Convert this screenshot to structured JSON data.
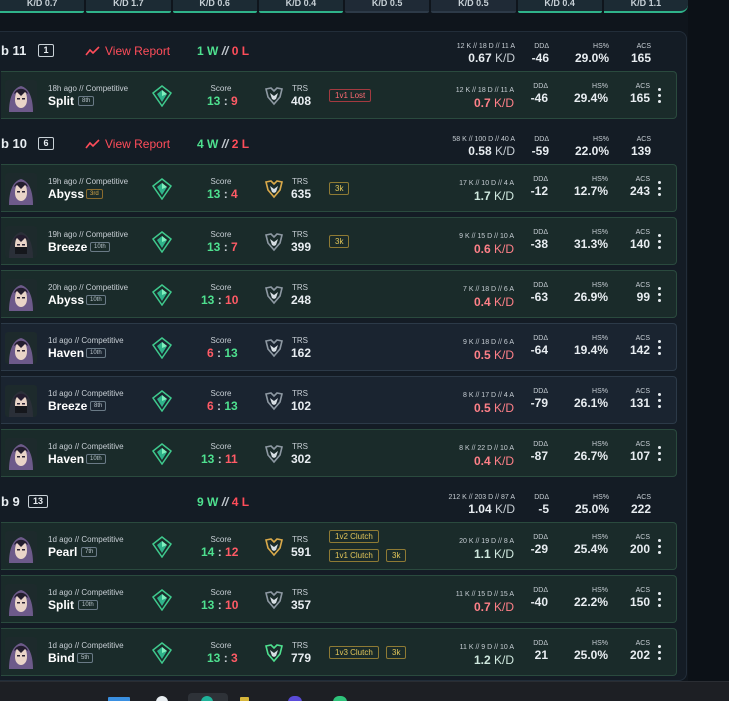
{
  "top_tabs": [
    "K/D 0.7",
    "K/D 1.7",
    "K/D 0.6",
    "K/D 0.4",
    "K/D 0.5",
    "K/D 0.5",
    "K/D 0.4",
    "K/D 1.1"
  ],
  "sessions": [
    {
      "title": "b 11",
      "count": "1",
      "report": "View Report",
      "wins": "1 W",
      "sep": "//",
      "losses": "0 L",
      "kda_line": "12 K // 18 D // 11 A",
      "kd": "0.67",
      "kd_unit": "K/D",
      "dda_label": "DDΔ",
      "dda": "-46",
      "hs_label": "HS%",
      "hs": "29.0%",
      "acs_label": "ACS",
      "acs": "165",
      "matches": [
        {
          "time": "18h ago // Competitive",
          "map": "Split",
          "place": "8th",
          "score_label": "Score",
          "score_a": "13",
          "score_b": "9",
          "score_sep": ":",
          "score_a_win": true,
          "trs_label": "TRS",
          "trs": "408",
          "tags": [
            {
              "text": "1v1 Lost",
              "style": "red"
            }
          ],
          "kda_line": "12 K // 18 D // 11 A",
          "kd": "0.7",
          "kd_unit": "K/D",
          "kd_good": false,
          "dda": "-46",
          "hs": "29.4%",
          "acs": "165",
          "win": true
        }
      ]
    },
    {
      "title": "b 10",
      "count": "6",
      "report": "View Report",
      "wins": "4 W",
      "sep": "//",
      "losses": "2 L",
      "kda_line": "58 K // 100 D // 40 A",
      "kd": "0.58",
      "kd_unit": "K/D",
      "dda_label": "DDΔ",
      "dda": "-59",
      "hs_label": "HS%",
      "hs": "22.0%",
      "acs_label": "ACS",
      "acs": "139",
      "matches": [
        {
          "time": "19h ago // Competitive",
          "map": "Abyss",
          "place": "3rd",
          "place_gold": true,
          "score_label": "Score",
          "score_a": "13",
          "score_b": "4",
          "score_sep": ":",
          "score_a_win": true,
          "trs_label": "TRS",
          "trs": "635",
          "trs_gold": true,
          "tags": [
            {
              "text": "3k",
              "style": "gold"
            }
          ],
          "kda_line": "17 K // 10 D // 4 A",
          "kd": "1.7",
          "kd_unit": "K/D",
          "kd_good": true,
          "dda": "-12",
          "hs": "12.7%",
          "acs": "243",
          "win": true
        },
        {
          "time": "19h ago // Competitive",
          "map": "Breeze",
          "place": "10th",
          "score_label": "Score",
          "score_a": "13",
          "score_b": "7",
          "score_sep": ":",
          "score_a_win": true,
          "trs_label": "TRS",
          "trs": "399",
          "tags": [
            {
              "text": "3k",
              "style": "gold"
            }
          ],
          "kda_line": "9 K // 15 D // 10 A",
          "kd": "0.6",
          "kd_unit": "K/D",
          "kd_good": false,
          "dda": "-38",
          "hs": "31.3%",
          "acs": "140",
          "win": true
        },
        {
          "time": "20h ago // Competitive",
          "map": "Abyss",
          "place": "10th",
          "score_label": "Score",
          "score_a": "13",
          "score_b": "10",
          "score_sep": ":",
          "score_a_win": true,
          "trs_label": "TRS",
          "trs": "248",
          "tags": [],
          "kda_line": "7 K // 18 D // 6 A",
          "kd": "0.4",
          "kd_unit": "K/D",
          "kd_good": false,
          "dda": "-63",
          "hs": "26.9%",
          "acs": "99",
          "win": true
        },
        {
          "time": "1d ago // Competitive",
          "map": "Haven",
          "place": "10th",
          "score_label": "Score",
          "score_a": "6",
          "score_b": "13",
          "score_sep": ":",
          "score_a_win": false,
          "trs_label": "TRS",
          "trs": "162",
          "tags": [],
          "kda_line": "9 K // 18 D // 6 A",
          "kd": "0.5",
          "kd_unit": "K/D",
          "kd_good": false,
          "dda": "-64",
          "hs": "19.4%",
          "acs": "142",
          "win": false
        },
        {
          "time": "1d ago // Competitive",
          "map": "Breeze",
          "place": "8th",
          "score_label": "Score",
          "score_a": "6",
          "score_b": "13",
          "score_sep": ":",
          "score_a_win": false,
          "trs_label": "TRS",
          "trs": "102",
          "tags": [],
          "kda_line": "8 K // 17 D // 4 A",
          "kd": "0.5",
          "kd_unit": "K/D",
          "kd_good": false,
          "dda": "-79",
          "hs": "26.1%",
          "acs": "131",
          "win": false
        },
        {
          "time": "1d ago // Competitive",
          "map": "Haven",
          "place": "10th",
          "score_label": "Score",
          "score_a": "13",
          "score_b": "11",
          "score_sep": ":",
          "score_a_win": true,
          "trs_label": "TRS",
          "trs": "302",
          "tags": [],
          "kda_line": "8 K // 22 D // 10 A",
          "kd": "0.4",
          "kd_unit": "K/D",
          "kd_good": false,
          "dda": "-87",
          "hs": "26.7%",
          "acs": "107",
          "win": true
        }
      ]
    },
    {
      "title": "b 9",
      "count": "13",
      "report": "",
      "wins": "9 W",
      "sep": "//",
      "losses": "4 L",
      "kda_line": "212 K // 203 D // 87 A",
      "kd": "1.04",
      "kd_unit": "K/D",
      "dda_label": "DDΔ",
      "dda": "-5",
      "hs_label": "HS%",
      "hs": "25.0%",
      "acs_label": "ACS",
      "acs": "222",
      "matches": [
        {
          "time": "1d ago // Competitive",
          "map": "Pearl",
          "place": "7th",
          "score_label": "Score",
          "score_a": "14",
          "score_b": "12",
          "score_sep": ":",
          "score_a_win": true,
          "trs_label": "TRS",
          "trs": "591",
          "trs_gold": true,
          "tags": [
            {
              "text": "1v2 Clutch",
              "style": "gold"
            },
            {
              "text": "1v1 Clutch",
              "style": "gold"
            },
            {
              "text": "3k",
              "style": "gold"
            }
          ],
          "kda_line": "20 K // 19 D // 8 A",
          "kd": "1.1",
          "kd_unit": "K/D",
          "kd_good": true,
          "dda": "-29",
          "hs": "25.4%",
          "acs": "200",
          "win": true
        },
        {
          "time": "1d ago // Competitive",
          "map": "Split",
          "place": "10th",
          "score_label": "Score",
          "score_a": "13",
          "score_b": "10",
          "score_sep": ":",
          "score_a_win": true,
          "trs_label": "TRS",
          "trs": "357",
          "tags": [],
          "kda_line": "11 K // 15 D // 15 A",
          "kd": "0.7",
          "kd_unit": "K/D",
          "kd_good": false,
          "dda": "-40",
          "hs": "22.2%",
          "acs": "150",
          "win": true
        },
        {
          "time": "1d ago // Competitive",
          "map": "Bind",
          "place": "5th",
          "score_label": "Score",
          "score_a": "13",
          "score_b": "3",
          "score_sep": ":",
          "score_a_win": true,
          "trs_label": "TRS",
          "trs": "779",
          "trs_green": true,
          "tags": [
            {
              "text": "1v3 Clutch",
              "style": "gold"
            },
            {
              "text": "3k",
              "style": "gold"
            }
          ],
          "kda_line": "11 K // 9 D // 10 A",
          "kd": "1.2",
          "kd_unit": "K/D",
          "kd_good": true,
          "dda": "21",
          "hs": "25.0%",
          "acs": "202",
          "win": true
        }
      ]
    }
  ],
  "colors": {
    "win": "#4ee08f",
    "loss": "#ff4d5a",
    "accent": "#2fb38a",
    "gold": "#e3c65a"
  }
}
